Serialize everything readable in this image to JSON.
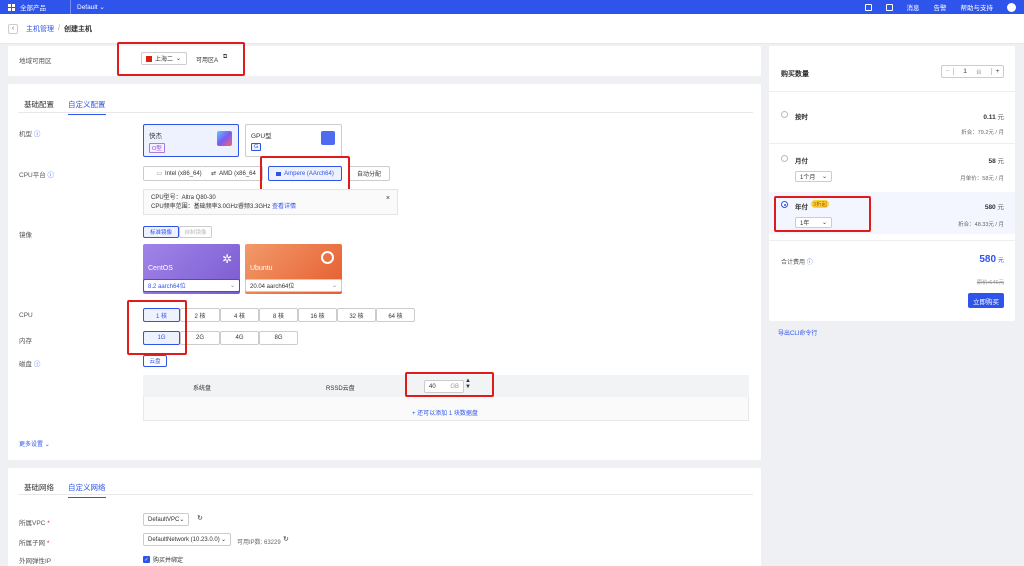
{
  "topbar": {
    "products_label": "全部产品",
    "project_label": "Default",
    "items": [
      "消息",
      "告警",
      "帮助与支持"
    ]
  },
  "breadcrumb": {
    "parent": "主机管理",
    "separator": "/",
    "current": "创建主机"
  },
  "zone": {
    "label": "地域可用区",
    "region": "上海二",
    "az": "可用区A"
  },
  "config_tabs": [
    "基础配置",
    "自定义配置"
  ],
  "model": {
    "label": "机型",
    "options": [
      {
        "name": "快杰",
        "tag": "O型"
      },
      {
        "name": "GPU型",
        "tag": "G"
      }
    ]
  },
  "cpu_platform": {
    "label": "CPU平台",
    "options": [
      "Intel (x86_64)",
      "AMD (x86_64",
      "Ampere (AArch64)",
      "自动分配"
    ],
    "info_line1": "CPU型号：Altra Q80-30",
    "info_line2": "CPU频率范围：基础频率3.0GHz睿频3.3GHz",
    "info_link": "查看详情"
  },
  "image": {
    "label": "镜像",
    "subtabs": [
      "标准镜像",
      "自制镜像"
    ],
    "cards": [
      {
        "name": "CentOS",
        "version": "8.2 aarch64位",
        "color": "#8b6fd6"
      },
      {
        "name": "Ubuntu",
        "version": "20.04 aarch64位",
        "color": "#e8673c"
      }
    ]
  },
  "cpu": {
    "label": "CPU",
    "options": [
      "1 核",
      "2 核",
      "4 核",
      "8 核",
      "16 核",
      "32 核",
      "64 核"
    ]
  },
  "memory": {
    "label": "内存",
    "options": [
      "1G",
      "2G",
      "4G",
      "8G"
    ]
  },
  "disk": {
    "label": "磁盘",
    "tab": "云盘",
    "system_label": "系统盘",
    "type": "RSSD云盘",
    "size": "40",
    "unit": "GB",
    "add_more": "+ 还可以添加 1 块数据盘"
  },
  "more_settings": "更多设置",
  "network_tabs": [
    "基础网络",
    "自定义网络"
  ],
  "network": {
    "vpc_label": "所属VPC",
    "vpc_value": "DefaultVPC",
    "subnet_label": "所属子网",
    "subnet_value": "DefaultNetwork (10.23.0.0)",
    "available_ip": "可用IP数: 63229",
    "eip_label": "外网弹性IP",
    "eip_check": "购买并绑定"
  },
  "right_panel": {
    "qty_label": "购买数量",
    "qty_value": "1",
    "qty_unit": "台",
    "billing": [
      {
        "name": "按时",
        "price": "0.11",
        "unit": "元",
        "note": "折合：79.2元 / 月"
      },
      {
        "name": "月付",
        "price": "58",
        "unit": "元",
        "select": "1个月",
        "note": "月单价：58元 / 月"
      },
      {
        "name": "年付",
        "badge": "3折起",
        "price": "580",
        "unit": "元",
        "select": "1年",
        "note": "折合：48.33元 / 月"
      }
    ],
    "total_label": "合计费用",
    "total_price": "580",
    "total_unit": "元",
    "original_price": "原价:646元",
    "buy_button": "立即购买",
    "cli_link": "导出CLI命令行"
  },
  "colors": {
    "accent": "#2f54eb",
    "highlight": "#e01b1b"
  }
}
